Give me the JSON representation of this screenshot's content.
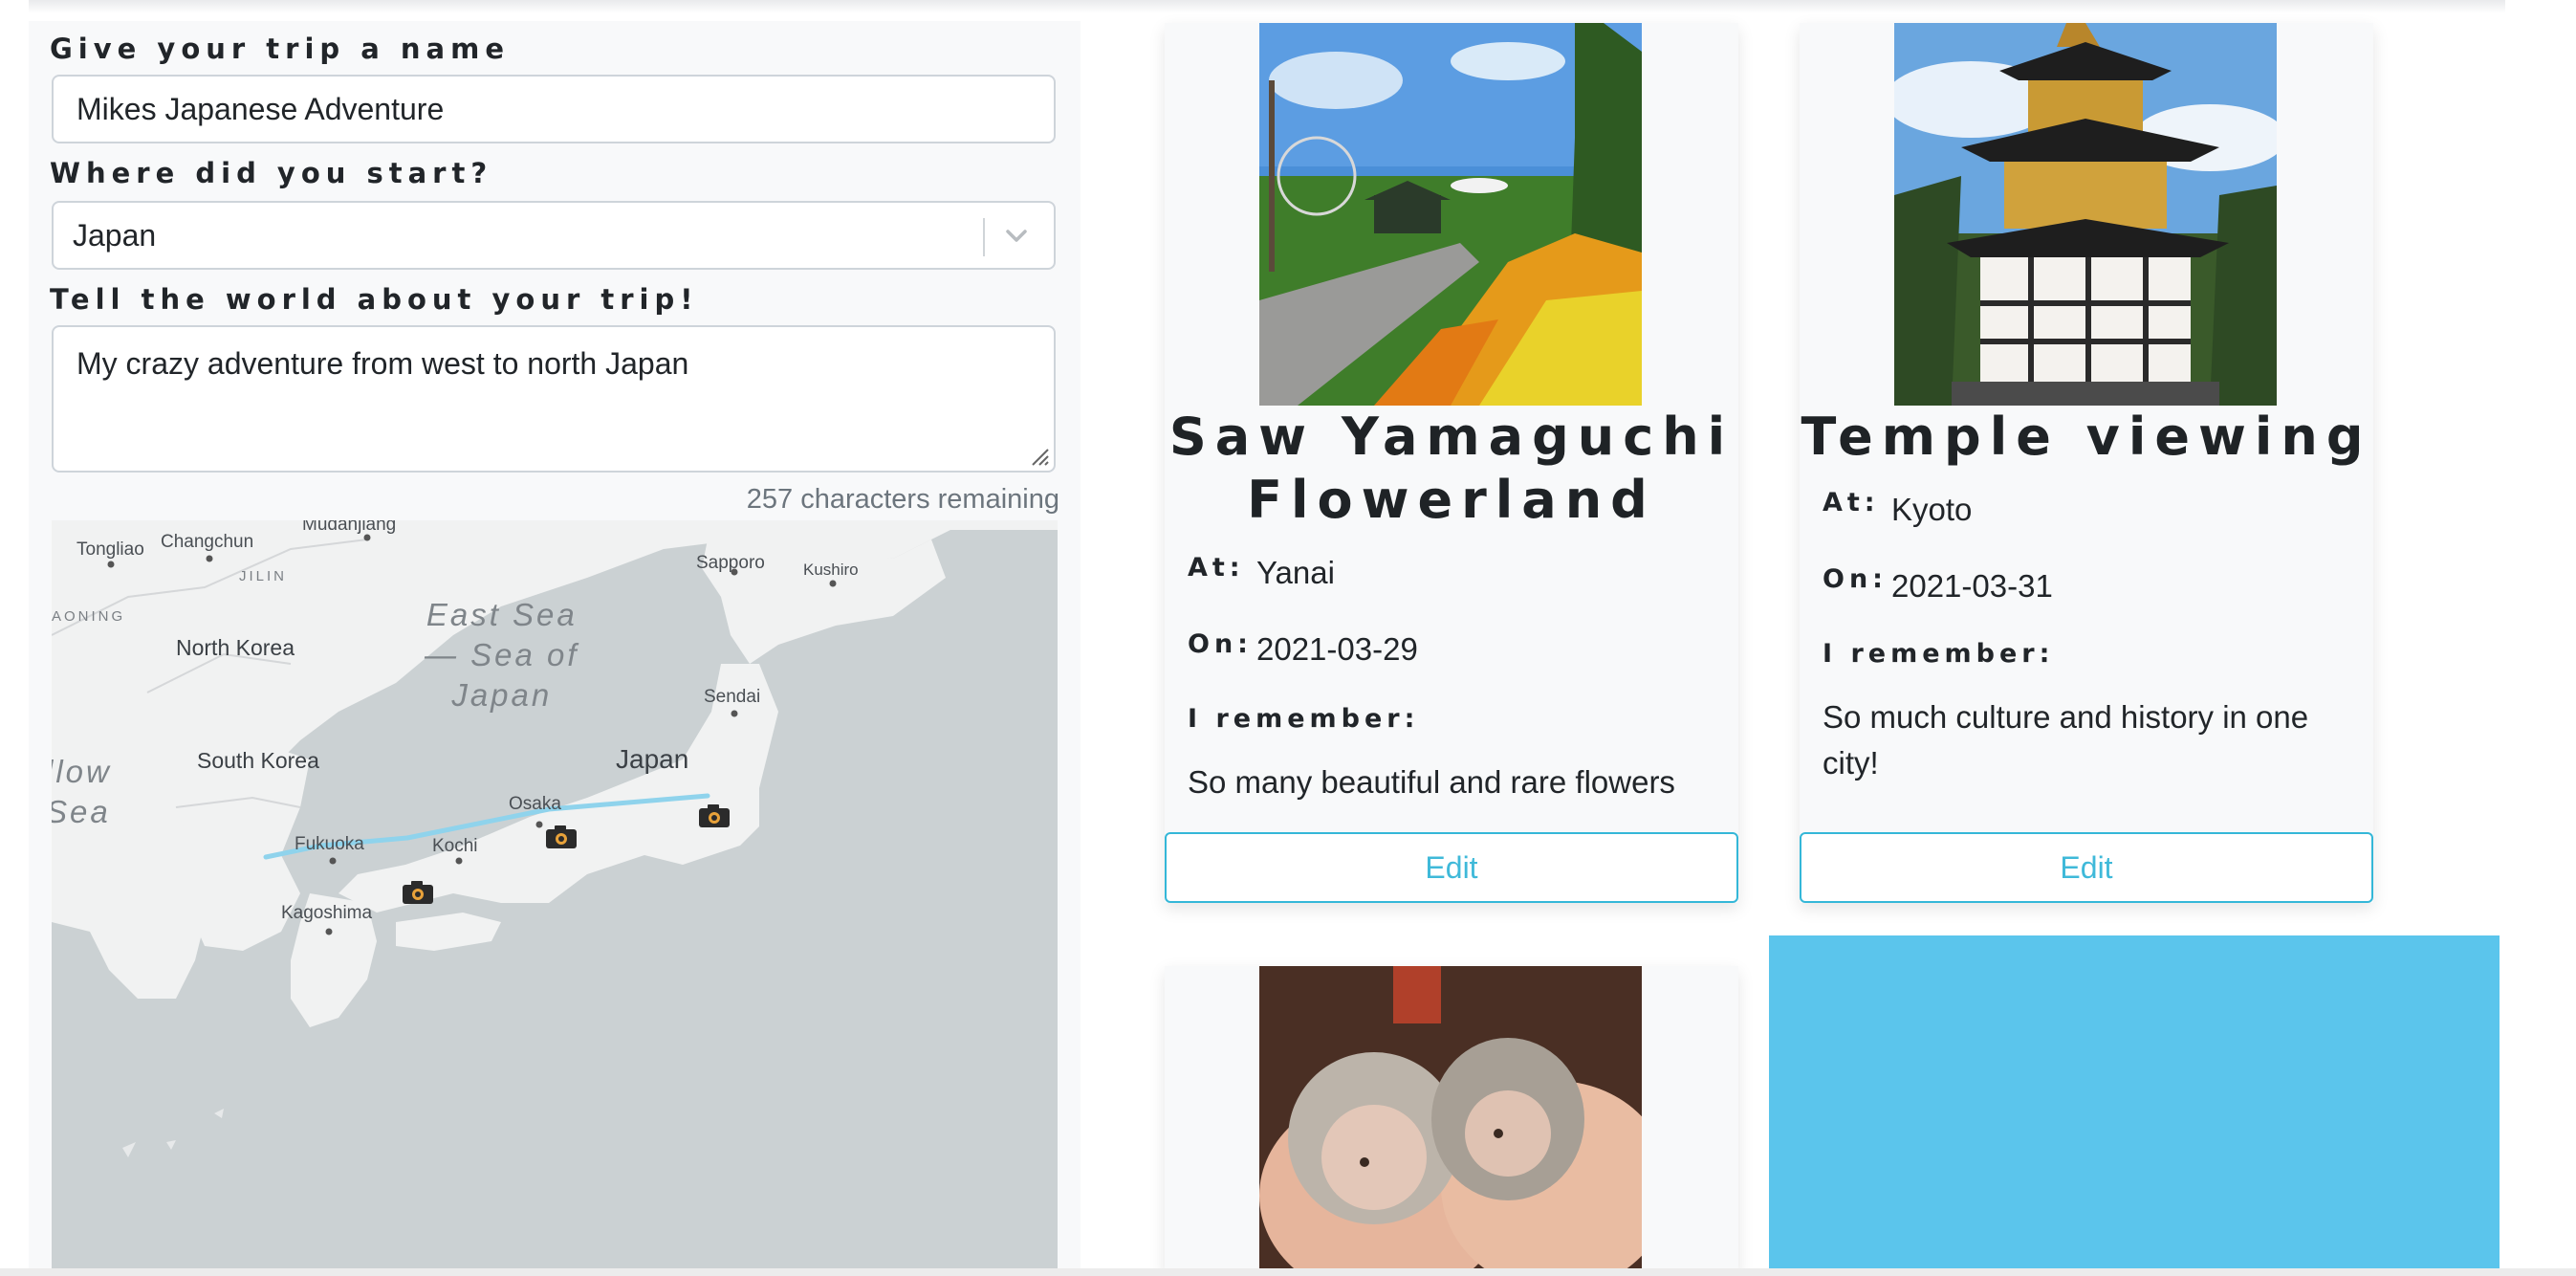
{
  "form": {
    "name_label": "Give your trip a name",
    "name_value": "Mikes Japanese Adventure",
    "start_label": "Where did you start?",
    "start_value": "Japan",
    "about_label": "Tell the world about your trip!",
    "about_value": "My crazy adventure from west to north Japan",
    "chars_remaining": "257 characters remaining"
  },
  "map": {
    "labels": {
      "tongliao": "Tongliao",
      "changchun": "Changchun",
      "mudanjiang": "Mudanjiang",
      "jilin": "JILIN",
      "aoning": "AONING",
      "sapporo": "Sapporo",
      "kushiro": "Kushiro",
      "east_sea": "East Sea\n— Sea of\nJapan",
      "north_korea": "North Korea",
      "sendai": "Sendai",
      "south_korea": "South Korea",
      "japan": "Japan",
      "yellow_sea": "llow\nSea",
      "osaka": "Osaka",
      "fukuoka": "Fukuoka",
      "kochi": "Kochi",
      "kagoshima": "Kagoshima"
    },
    "route_color": "#8fd3ec",
    "marker_icon": "camera-icon"
  },
  "cards": [
    {
      "title": "Saw Yamaguchi Flowerland",
      "at_label": "At:",
      "at_value": "Yanai",
      "on_label": "On:",
      "on_value": "2021-03-29",
      "remember_label": "I remember:",
      "memory": "So many beautiful and rare flowers",
      "edit_label": "Edit"
    },
    {
      "title": "Temple viewing",
      "at_label": "At:",
      "at_value": "Kyoto",
      "on_label": "On:",
      "on_value": "2021-03-31",
      "remember_label": "I remember:",
      "memory": "So much culture and history in one city!",
      "edit_label": "Edit"
    }
  ],
  "colors": {
    "accent": "#3fb9d9",
    "blue_block": "#5bc5ec",
    "panel_bg": "#f8f9fa"
  }
}
